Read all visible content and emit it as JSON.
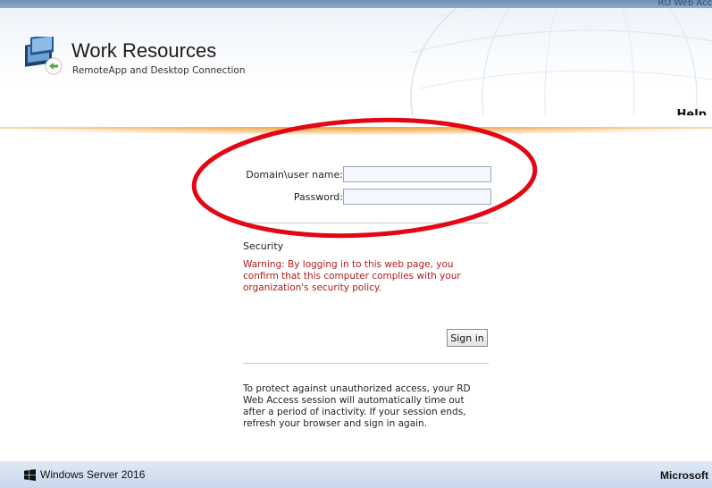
{
  "topbar": {
    "label": "RD Web Acc"
  },
  "header": {
    "title": "Work Resources",
    "subtitle": "RemoteApp and Desktop Connection",
    "help_label": "Help"
  },
  "form": {
    "username_label": "Domain\\user name:",
    "username_value": "",
    "password_label": "Password:",
    "password_value": ""
  },
  "security": {
    "title": "Security",
    "warning": "Warning: By logging in to this web page, you confirm that this computer complies with your organization's security policy."
  },
  "signin_label": "Sign in",
  "timeout_notice": "To protect against unauthorized access, your RD Web Access session will automatically time out after a period of inactivity. If your session ends, refresh your browser and sign in again.",
  "footer": {
    "left": "Windows Server 2016",
    "right": "Microsoft"
  },
  "colors": {
    "accent_orange": "#eea04a",
    "warning_red": "#b01c1c",
    "annotation_red": "#e30613"
  }
}
